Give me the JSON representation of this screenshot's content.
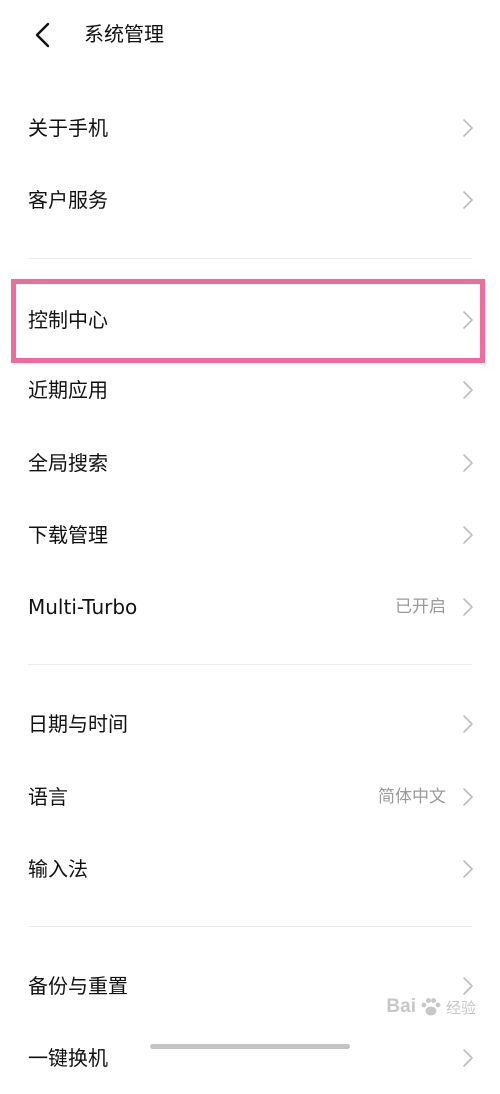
{
  "header": {
    "title": "系统管理"
  },
  "groups": [
    {
      "items": [
        {
          "label": "关于手机",
          "value": ""
        },
        {
          "label": "客户服务",
          "value": ""
        }
      ]
    },
    {
      "items": [
        {
          "label": "控制中心",
          "value": ""
        },
        {
          "label": "近期应用",
          "value": ""
        },
        {
          "label": "全局搜索",
          "value": ""
        },
        {
          "label": "下载管理",
          "value": ""
        },
        {
          "label": "Multi-Turbo",
          "value": "已开启"
        }
      ]
    },
    {
      "items": [
        {
          "label": "日期与时间",
          "value": ""
        },
        {
          "label": "语言",
          "value": "简体中文"
        },
        {
          "label": "输入法",
          "value": ""
        }
      ]
    },
    {
      "items": [
        {
          "label": "备份与重置",
          "value": ""
        },
        {
          "label": "一键换机",
          "value": ""
        }
      ]
    }
  ],
  "highlight": {
    "color": "#ee6b9c",
    "target": "控制中心"
  },
  "watermark": {
    "brand": "Bai",
    "brand2": "经验",
    "paw_color": "#9a9a9a"
  },
  "icons": {
    "back": "chevron-left-icon",
    "row": "chevron-right-icon"
  }
}
